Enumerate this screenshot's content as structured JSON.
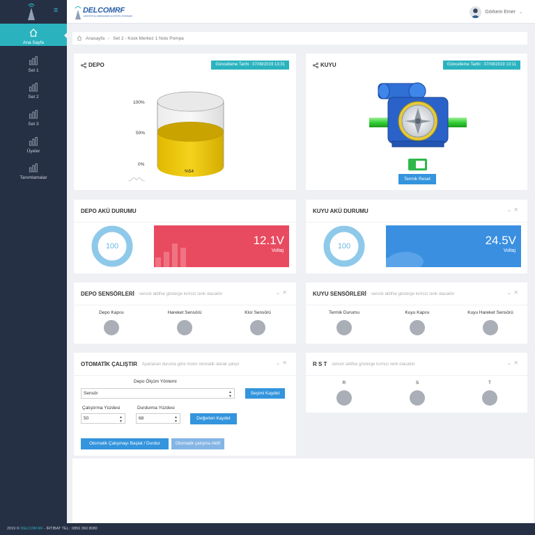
{
  "nav": {
    "items": [
      {
        "label": "Ana Sayfa",
        "icon": "home-icon"
      },
      {
        "label": "Set 1",
        "icon": "bar-chart-icon"
      },
      {
        "label": "Set 2",
        "icon": "bar-chart-icon"
      },
      {
        "label": "Set 3",
        "icon": "bar-chart-icon"
      },
      {
        "label": "Üyeler",
        "icon": "bar-chart-icon"
      },
      {
        "label": "Tanımlamalar",
        "icon": "bar-chart-icon"
      }
    ]
  },
  "header": {
    "brand": "DELCOMRF",
    "brand_tagline": "ENDÜSTRİYEL HABERLEŞME VE KONTROL SİSTEMLERİ",
    "user_name": "Görkem Emer"
  },
  "breadcrumb": {
    "home": "Anasayfa",
    "current": "Set 2 - Kosk Merkez 1 Nolu Pompa"
  },
  "depo": {
    "title": "DEPO",
    "updated": "Güncelleme Tarihi : 07/08/2019 13:31",
    "axis": [
      "100%",
      "50%",
      "0%"
    ],
    "level_percent": 54,
    "level_label": "%54"
  },
  "kuyu": {
    "title": "KUYU",
    "updated": "Güncelleme Tarihi : 07/08/2019 13:11",
    "reset_label": "Termik Reset"
  },
  "depo_battery": {
    "title": "DEPO AKÜ DURUMU",
    "percent": "100",
    "voltage": "12.1V",
    "voltage_label": "Voltaj",
    "color": "#e84a5f"
  },
  "kuyu_battery": {
    "title": "KUYU AKÜ DURUMU",
    "percent": "100",
    "voltage": "24.5V",
    "voltage_label": "Voltaj",
    "color": "#3a8fe0"
  },
  "depo_sensors": {
    "title": "DEPO SENSÖRLERİ",
    "subtitle": "sensör aktifse gösterge kırmızı renk olacaktır",
    "items": [
      "Depo Kapısı",
      "Hareket Sensörü",
      "Klor Sensörü"
    ]
  },
  "kuyu_sensors": {
    "title": "KUYU SENSÖRLERİ",
    "subtitle": "sensör aktifse gösterge kırmızı renk olacaktır",
    "items": [
      "Termik Durumu",
      "Kuyu Kapısı",
      "Kuyu Hareket Sensörü"
    ]
  },
  "auto": {
    "title": "OTOMATİK ÇALIŞTIR",
    "subtitle": "Ayarlanan duruma göre motor otomatik olarak çalışır",
    "method_label": "Depo Ölçüm Yöntemi",
    "method_value": "Sensör",
    "save_choice": "Seçimi Kaydet",
    "start_pct_label": "Çalıştırma Yüzdesi",
    "start_pct_value": "50",
    "stop_pct_label": "Durdurma Yüzdesi",
    "stop_pct_value": "68",
    "save_values": "Değerleri Kaydet",
    "toggle_button": "Otomatik Çalışmayı Başlat / Durdur",
    "status_button": "Otomatik çalışma Aktif"
  },
  "rst": {
    "title": "R S T",
    "subtitle": "sensör aktifse gösterge kırmızı renk olacaktır",
    "items": [
      "R",
      "S",
      "T"
    ]
  },
  "footer": {
    "year": "2019 ©",
    "brand": "DELCOM RF",
    "contact": "- İRTİBAT TEL : 0850 360 8080"
  }
}
